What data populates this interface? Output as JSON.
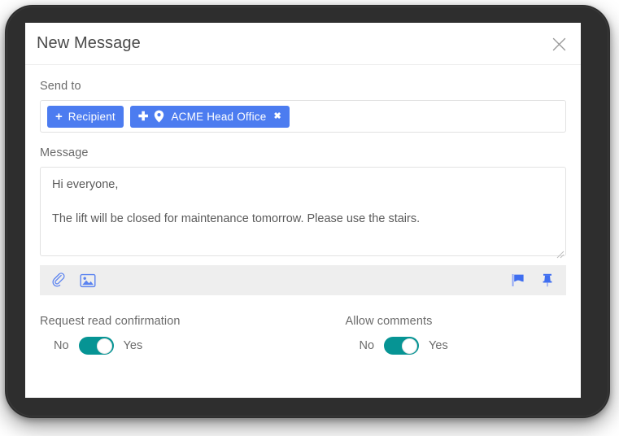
{
  "dialog": {
    "title": "New Message",
    "close_icon": "close-icon"
  },
  "send_to": {
    "label": "Send to",
    "add_recipient_chip": {
      "plus": "+",
      "label": "Recipient"
    },
    "recipients": [
      {
        "plus": "✚",
        "icon": "location-pin-icon",
        "label": "ACME Head Office",
        "remove": "✖"
      }
    ]
  },
  "message": {
    "label": "Message",
    "value": "Hi everyone,\n\nThe lift will be closed for maintenance tomorrow. Please use the stairs."
  },
  "toolbar": {
    "left_icons": [
      {
        "name": "attachment-icon"
      },
      {
        "name": "image-icon"
      }
    ],
    "right_icons": [
      {
        "name": "flag-icon"
      },
      {
        "name": "pin-icon"
      }
    ]
  },
  "options": [
    {
      "label": "Request read confirmation",
      "off_label": "No",
      "on_label": "Yes",
      "value": "Yes"
    },
    {
      "label": "Allow comments",
      "off_label": "No",
      "on_label": "Yes",
      "value": "Yes"
    }
  ],
  "colors": {
    "chip_blue": "#4c7cf0",
    "icon_blue": "#5b83f0",
    "toggle_teal": "#069494",
    "toolbar_gray": "#eeeeee",
    "bezel_dark": "#2e2e2e"
  }
}
